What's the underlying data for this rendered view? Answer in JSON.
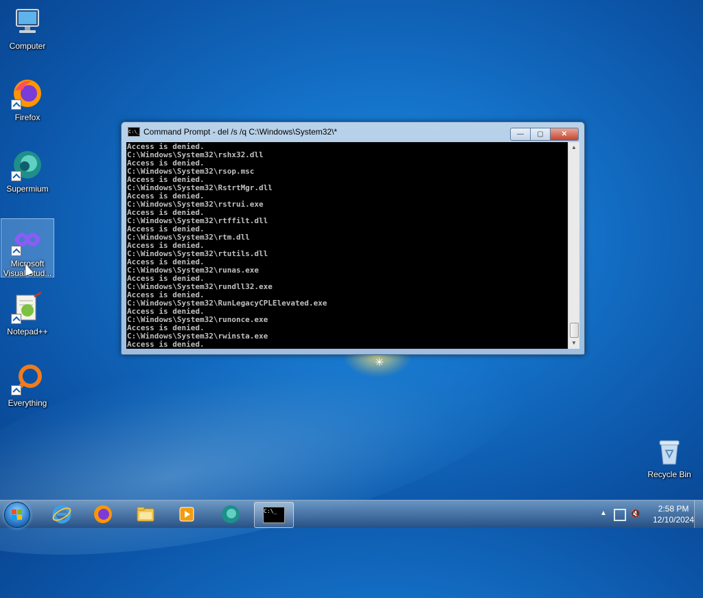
{
  "desktop": {
    "icons": [
      {
        "label": "Computer"
      },
      {
        "label": "Firefox"
      },
      {
        "label": "Supermium"
      },
      {
        "label": "Microsoft Visual Stud..."
      },
      {
        "label": "Notepad++"
      },
      {
        "label": "Everything"
      },
      {
        "label": "Recycle Bin"
      }
    ]
  },
  "cmd_window": {
    "title": "Command Prompt - del  /s /q C:\\Windows\\System32\\*",
    "icon_text": "C:\\_",
    "buttons": {
      "minimize": "—",
      "maximize": "▢",
      "close": "✕"
    },
    "lines": [
      "Access is denied.",
      "C:\\Windows\\System32\\rshx32.dll",
      "Access is denied.",
      "C:\\Windows\\System32\\rsop.msc",
      "Access is denied.",
      "C:\\Windows\\System32\\RstrtMgr.dll",
      "Access is denied.",
      "C:\\Windows\\System32\\rstrui.exe",
      "Access is denied.",
      "C:\\Windows\\System32\\rtffilt.dll",
      "Access is denied.",
      "C:\\Windows\\System32\\rtm.dll",
      "Access is denied.",
      "C:\\Windows\\System32\\rtutils.dll",
      "Access is denied.",
      "C:\\Windows\\System32\\runas.exe",
      "Access is denied.",
      "C:\\Windows\\System32\\rundll32.exe",
      "Access is denied.",
      "C:\\Windows\\System32\\RunLegacyCPLElevated.exe",
      "Access is denied.",
      "C:\\Windows\\System32\\runonce.exe",
      "Access is denied.",
      "C:\\Windows\\System32\\rwinsta.exe",
      "Access is denied."
    ]
  },
  "taskbar": {
    "items": [
      "internet-explorer-icon",
      "firefox-icon",
      "file-explorer-icon",
      "media-player-icon",
      "supermium-icon",
      "command-prompt-icon"
    ],
    "cmd_icon_text": "C:\\_",
    "tray_chevron": "▲",
    "volume_glyph": "🔇",
    "time": "2:58 PM",
    "date": "12/10/2024"
  },
  "colors": {
    "console_bg": "#000000",
    "console_text": "#c0c0c0",
    "accent": "#1472c8"
  }
}
